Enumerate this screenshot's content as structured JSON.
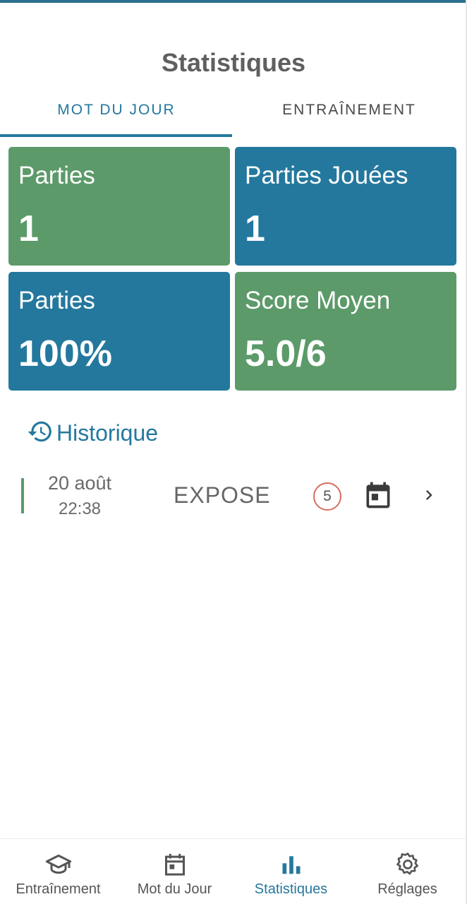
{
  "header": {
    "title": "Statistiques"
  },
  "tabs": [
    {
      "label": "MOT DU JOUR",
      "active": true
    },
    {
      "label": "ENTRAÎNEMENT",
      "active": false
    }
  ],
  "stats": [
    {
      "label": "Parties",
      "value": "1",
      "color": "#5c9a69"
    },
    {
      "label": "Parties Jouées",
      "value": "1",
      "color": "#24789e"
    },
    {
      "label": "Parties",
      "value": "100%",
      "color": "#24789e"
    },
    {
      "label": "Score Moyen",
      "value": "5.0/6",
      "color": "#5c9a69"
    }
  ],
  "history": {
    "title": "Historique",
    "icon": "history-icon",
    "rows": [
      {
        "date": "20 août",
        "time": "22:38",
        "word": "EXPOSE",
        "score": "5",
        "type_icon": "calendar-icon"
      }
    ]
  },
  "bottom_nav": [
    {
      "label": "Entraînement",
      "icon": "graduation-cap-icon",
      "active": false
    },
    {
      "label": "Mot du Jour",
      "icon": "calendar-icon",
      "active": false
    },
    {
      "label": "Statistiques",
      "icon": "bar-chart-icon",
      "active": true
    },
    {
      "label": "Réglages",
      "icon": "gear-icon",
      "active": false
    }
  ],
  "colors": {
    "accent": "#25789e",
    "green": "#5c9a69",
    "blue": "#24789e",
    "score_ring": "#d56e62"
  }
}
